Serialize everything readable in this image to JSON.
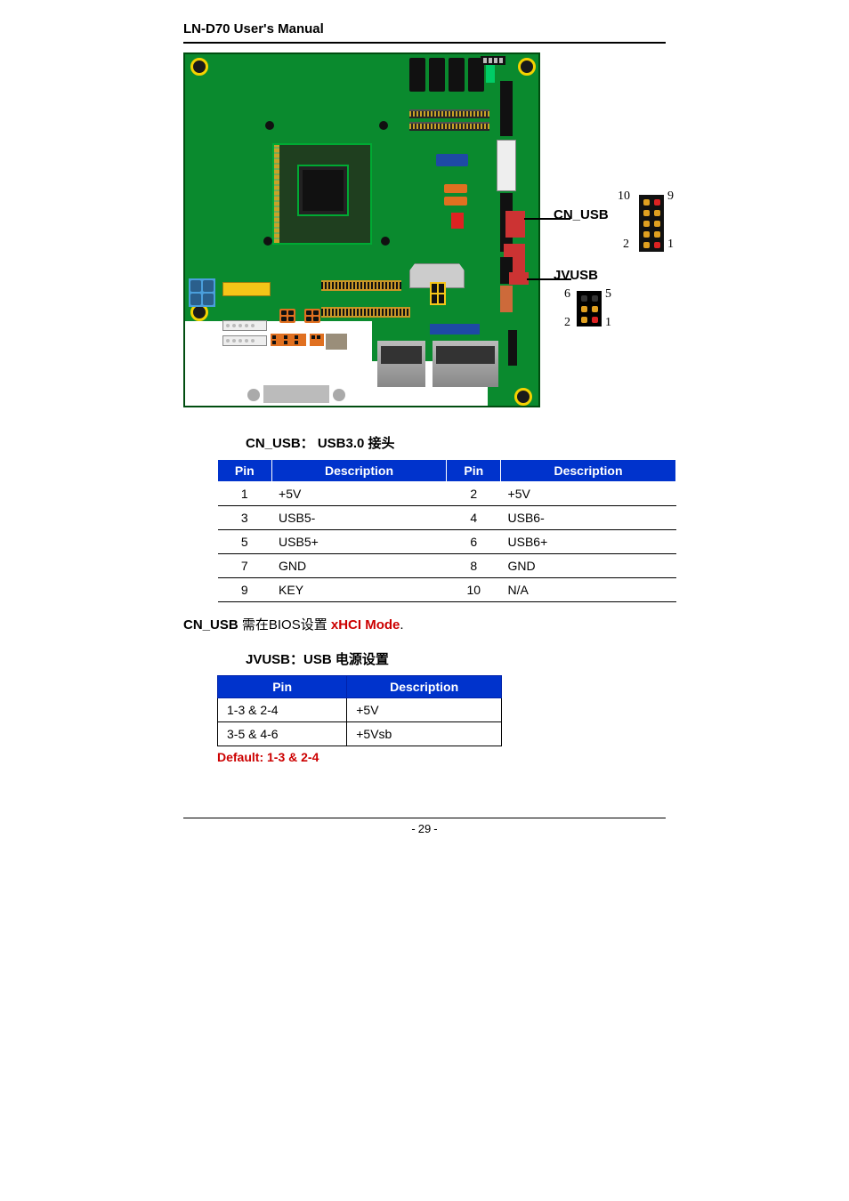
{
  "header": {
    "title": "LN-D70 User's Manual"
  },
  "figure": {
    "callouts": {
      "cn_usb": "CN_USB",
      "jvusb": "JVUSB"
    },
    "cn_usb_pins": {
      "p10": "10",
      "p9": "9",
      "p2": "2",
      "p1": "1"
    },
    "jvusb_pins": {
      "p6": "6",
      "p5": "5",
      "p2": "2",
      "p1": "1"
    }
  },
  "cn_usb": {
    "header_label": "CN_USB： USB3.0 接头",
    "columns": {
      "pin": "Pin",
      "desc": "Description"
    },
    "rows": [
      {
        "pin_a": "1",
        "desc_a": "+5V",
        "pin_b": "2",
        "desc_b": "+5V"
      },
      {
        "pin_a": "3",
        "desc_a": "USB5-",
        "pin_b": "4",
        "desc_b": "USB6-"
      },
      {
        "pin_a": "5",
        "desc_a": "USB5+",
        "pin_b": "6",
        "desc_b": "USB6+"
      },
      {
        "pin_a": "7",
        "desc_a": "GND",
        "pin_b": "8",
        "desc_b": "GND"
      },
      {
        "pin_a": "9",
        "desc_a": "KEY",
        "pin_b": "10",
        "desc_b": "N/A"
      }
    ],
    "note_prefix": "CN_USB",
    "note_mid_a": " 需在BIOS设置 ",
    "note_red": "xHCI Mode",
    "note_mid_b": "."
  },
  "jvusb": {
    "header_label": "JVUSB：USB 电源设置",
    "columns": {
      "pin": "Pin",
      "desc": "Description"
    },
    "rows": [
      {
        "pin": "1-3 & 2-4",
        "desc": "+5V"
      },
      {
        "pin": "3-5 & 4-6",
        "desc": "+5Vsb"
      }
    ],
    "default": "Default: 1-3 & 2-4"
  },
  "footer": {
    "page": "29"
  }
}
